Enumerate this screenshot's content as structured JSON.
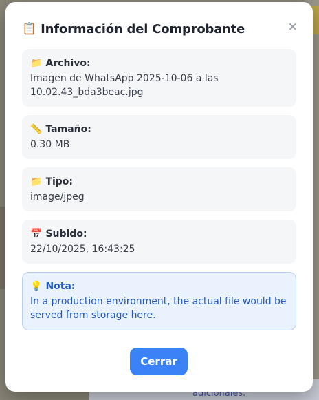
{
  "modal": {
    "title_icon": "📋",
    "title": "Información del Comprobante",
    "close_glyph": "×"
  },
  "details": [
    {
      "icon": "📁",
      "icon_name": "folder-icon",
      "label": "Archivo:",
      "value": "Imagen de WhatsApp 2025-10-06 a las 10.02.43_bda3beac.jpg"
    },
    {
      "icon": "📏",
      "icon_name": "ruler-icon",
      "label": "Tamaño:",
      "value": "0.30 MB"
    },
    {
      "icon": "📁",
      "icon_name": "folder-icon",
      "label": "Tipo:",
      "value": "image/jpeg"
    },
    {
      "icon": "📅",
      "icon_name": "calendar-icon",
      "label": "Subido:",
      "value": "22/10/2025, 16:43:25"
    }
  ],
  "note": {
    "icon": "💡",
    "icon_name": "lightbulb-icon",
    "label": "Nota:",
    "value": "In a production environment, the actual file would be served from storage here."
  },
  "footer": {
    "close_label": "Cerrar"
  },
  "background": {
    "bottom_text": "adicionales."
  },
  "colors": {
    "accent": "#3b82f6",
    "note_text": "#2559c9",
    "note_bg": "#eaf2fe"
  }
}
